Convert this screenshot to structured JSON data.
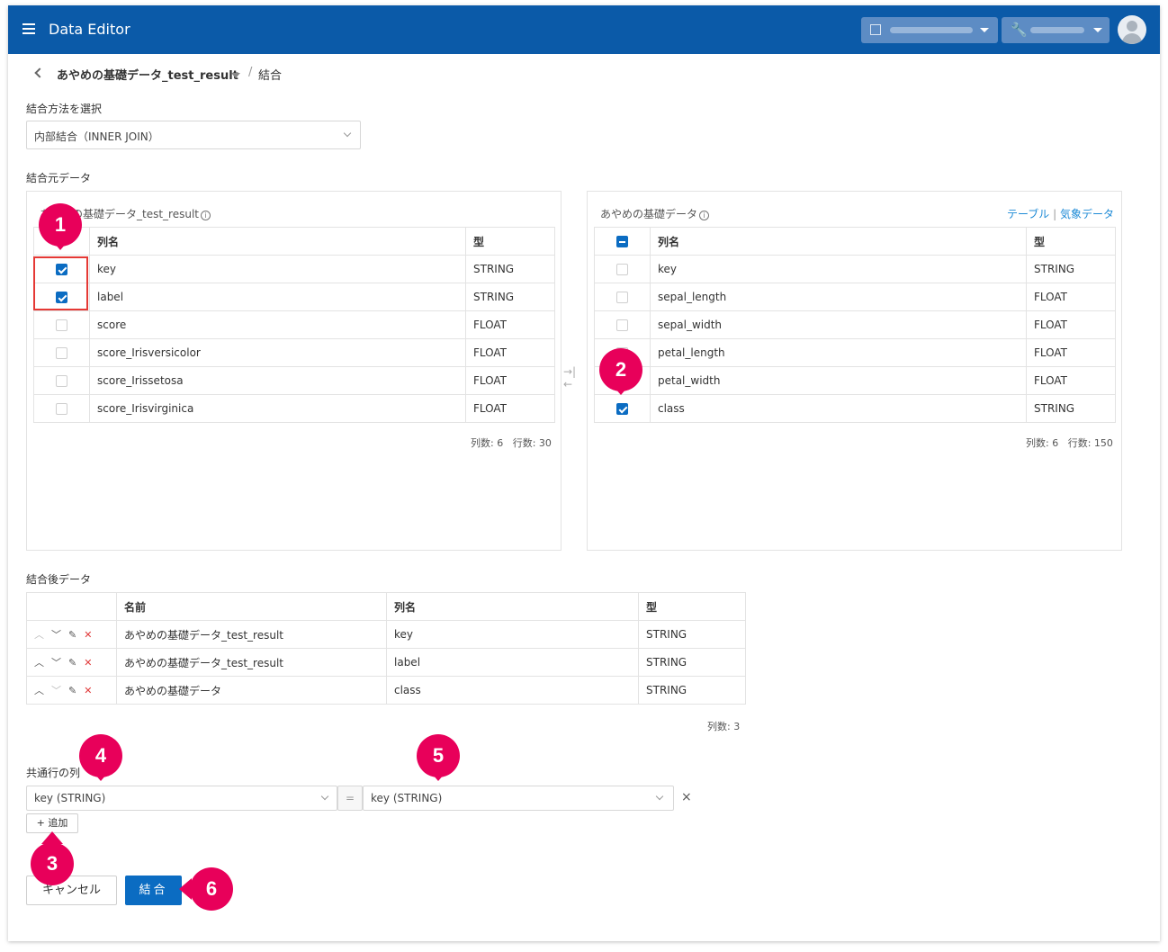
{
  "app": {
    "title": "Data Editor"
  },
  "breadcrumb": {
    "dataset": "あやめの基礎データ_test_result",
    "separator": "/",
    "current": "結合"
  },
  "join_method": {
    "label": "結合方法を選択",
    "value": "内部結合（INNER JOIN）"
  },
  "source_label": "結合元データ",
  "left_table": {
    "title": "あやめの基礎データ_test_result",
    "headers": {
      "name": "列名",
      "type": "型"
    },
    "rows": [
      {
        "name": "key",
        "type": "STRING",
        "checked": true
      },
      {
        "name": "label",
        "type": "STRING",
        "checked": true
      },
      {
        "name": "score",
        "type": "FLOAT",
        "checked": false
      },
      {
        "name": "score_Irisversicolor",
        "type": "FLOAT",
        "checked": false
      },
      {
        "name": "score_Irissetosa",
        "type": "FLOAT",
        "checked": false
      },
      {
        "name": "score_Irisvirginica",
        "type": "FLOAT",
        "checked": false
      }
    ],
    "stats_cols": "列数: 6",
    "stats_rows": "行数: 30"
  },
  "right_table": {
    "title": "あやめの基礎データ",
    "link_table": "テーブル",
    "link_sep": "|",
    "link_weather": "気象データ",
    "headers": {
      "name": "列名",
      "type": "型"
    },
    "rows": [
      {
        "name": "key",
        "type": "STRING",
        "checked": false
      },
      {
        "name": "sepal_length",
        "type": "FLOAT",
        "checked": false
      },
      {
        "name": "sepal_width",
        "type": "FLOAT",
        "checked": false
      },
      {
        "name": "petal_length",
        "type": "FLOAT",
        "checked": false
      },
      {
        "name": "petal_width",
        "type": "FLOAT",
        "checked": false
      },
      {
        "name": "class",
        "type": "STRING",
        "checked": true
      }
    ],
    "stats_cols": "列数: 6",
    "stats_rows": "行数: 150"
  },
  "result": {
    "label": "結合後データ",
    "headers": {
      "name": "名前",
      "column": "列名",
      "type": "型"
    },
    "rows": [
      {
        "name": "あやめの基礎データ_test_result",
        "column": "key",
        "type": "STRING"
      },
      {
        "name": "あやめの基礎データ_test_result",
        "column": "label",
        "type": "STRING"
      },
      {
        "name": "あやめの基礎データ",
        "column": "class",
        "type": "STRING"
      }
    ],
    "stats": "列数: 3"
  },
  "common": {
    "label": "共通行の列",
    "left_value": "key (STRING)",
    "equals": "=",
    "right_value": "key (STRING)",
    "remove": "×"
  },
  "buttons": {
    "add": "追加",
    "add_icon": "+",
    "cancel": "キャンセル",
    "join": "結合"
  },
  "markers": [
    "1",
    "2",
    "3",
    "4",
    "5",
    "6"
  ],
  "colors": {
    "appbar": "#0b5aa8",
    "primary": "#0b6cc2",
    "marker": "#e8005a",
    "highlight": "#e53935",
    "link": "#1d8ad6"
  }
}
